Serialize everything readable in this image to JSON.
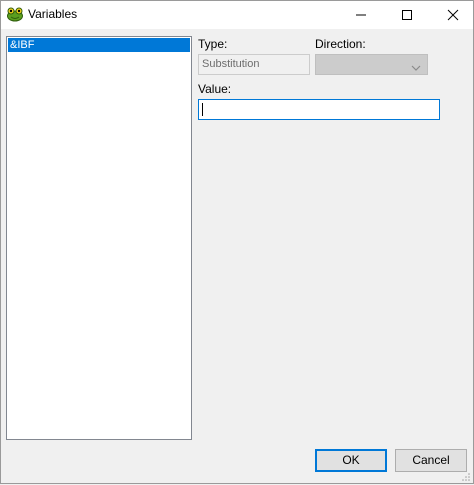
{
  "window": {
    "title": "Variables",
    "icon": "frog-app-icon"
  },
  "title_buttons": {
    "minimize_icon": "minimize-icon",
    "maximize_icon": "maximize-icon",
    "close_icon": "close-icon"
  },
  "variables_list": {
    "items": [
      {
        "label": "&IBF",
        "selected": true
      }
    ]
  },
  "fields": {
    "type_label": "Type:",
    "type_value": "Substitution",
    "direction_label": "Direction:",
    "direction_value": "",
    "value_label": "Value:",
    "value_value": ""
  },
  "buttons": {
    "ok_label": "OK",
    "cancel_label": "Cancel"
  },
  "colors": {
    "selection": "#0078d7",
    "focus_border": "#0078d7",
    "dialog_bg": "#f0f0f0"
  }
}
